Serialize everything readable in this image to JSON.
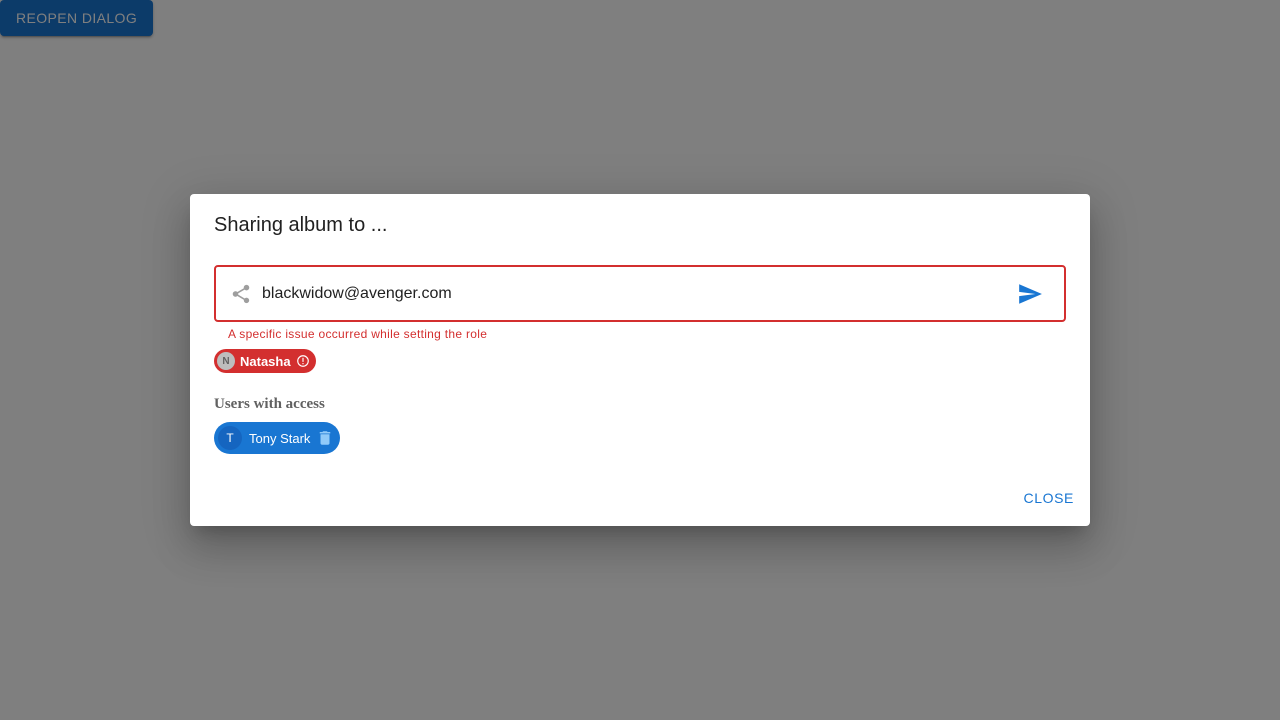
{
  "page": {
    "reopen_label": "Reopen dialog"
  },
  "dialog": {
    "title": "Sharing album to ...",
    "input": {
      "value": "blackwidow@avenger.com",
      "helper_text": "A specific issue occurred while setting the role"
    },
    "pending_chip": {
      "avatar_letter": "N",
      "label": "Natasha",
      "status": "error",
      "status_icon": "error-outline-icon"
    },
    "users_section": {
      "heading": "Users with access",
      "users": [
        {
          "avatar_letter": "T",
          "name": "Tony Stark",
          "action_icon": "delete-icon"
        }
      ]
    },
    "close_label": "Close"
  },
  "colors": {
    "primary": "#1976d2",
    "error": "#d32f2f",
    "backdrop": "rgba(0,0,0,0.5)"
  },
  "icons": {
    "input_leading": "share-icon",
    "input_trailing": "send-icon"
  }
}
